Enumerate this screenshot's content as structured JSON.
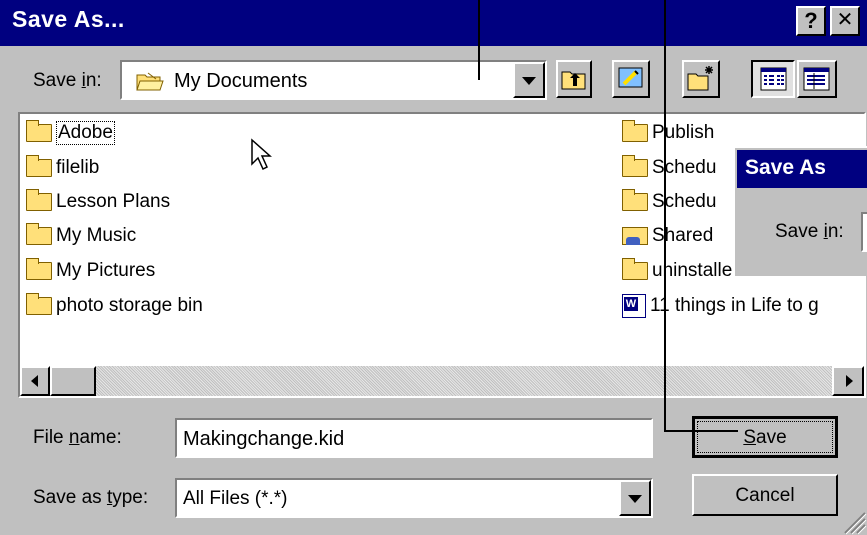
{
  "window": {
    "title": "Save As...",
    "help_button": "?",
    "close_button": "✕"
  },
  "save_in": {
    "label_pre": "Save ",
    "label_key": "i",
    "label_post": "n:",
    "value": "My Documents",
    "folder_icon": "open-folder-icon"
  },
  "toolbar": {
    "up_one_level_icon": "up-folder-icon",
    "desktop_icon": "desktop-icon",
    "new_folder_icon": "new-folder-icon",
    "list_view_icon": "list-view-icon",
    "details_view_icon": "details-view-icon"
  },
  "files": {
    "left_column": [
      {
        "name": "Adobe",
        "icon": "folder-icon",
        "focused": true
      },
      {
        "name": "filelib",
        "icon": "folder-icon"
      },
      {
        "name": "Lesson Plans",
        "icon": "folder-icon"
      },
      {
        "name": "My Music",
        "icon": "folder-icon"
      },
      {
        "name": "My Pictures",
        "icon": "folder-icon"
      },
      {
        "name": "photo storage bin",
        "icon": "folder-icon"
      }
    ],
    "right_column": [
      {
        "name": "Publish",
        "icon": "folder-icon"
      },
      {
        "name": "Schedu",
        "icon": "folder-icon"
      },
      {
        "name": "Schedu",
        "icon": "folder-icon"
      },
      {
        "name": "Shared",
        "icon": "shared-folder-icon"
      },
      {
        "name": "uninstalledfonts",
        "icon": "folder-icon"
      },
      {
        "name": "11 things in Life to g",
        "icon": "word-document-icon"
      }
    ]
  },
  "file_name": {
    "label_pre": "File ",
    "label_key": "n",
    "label_post": "ame:",
    "value": "Makingchange.kid"
  },
  "save_as_type": {
    "label_pre": "Save as ",
    "label_key": "t",
    "label_post": "ype:",
    "value": "All Files (*.*)"
  },
  "buttons": {
    "save_key": "S",
    "save_rest": "ave",
    "cancel": "Cancel"
  },
  "overlay_dialog": {
    "title": "Save As",
    "save_in_pre": "Save ",
    "save_in_key": "i",
    "save_in_post": "n:"
  },
  "colors": {
    "titlebar": "#000080",
    "face": "#c0c0c0",
    "field": "#ffffff"
  }
}
